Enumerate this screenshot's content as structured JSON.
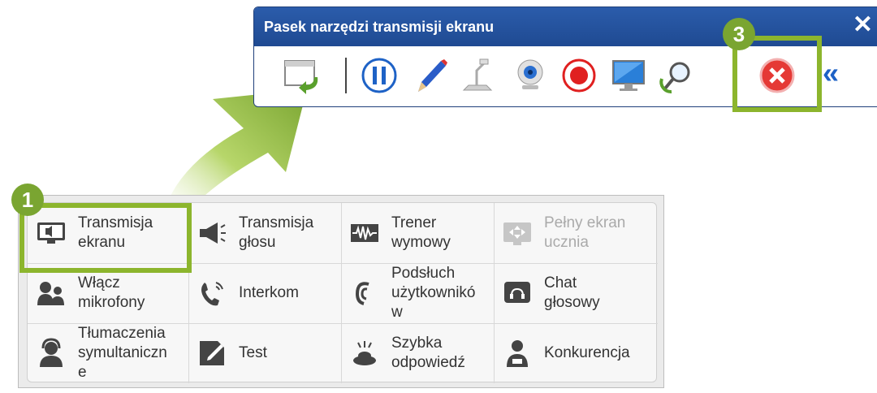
{
  "toolbar": {
    "title": "Pasek narzędzi transmisji ekranu",
    "close_glyph": "✕",
    "buttons": [
      {
        "name": "return-window-icon"
      },
      {
        "name": "pause-icon"
      },
      {
        "name": "pencil-icon"
      },
      {
        "name": "document-camera-icon"
      },
      {
        "name": "webcam-icon"
      },
      {
        "name": "record-icon"
      },
      {
        "name": "monitor-icon"
      },
      {
        "name": "zoom-icon"
      },
      {
        "name": "stop-icon"
      }
    ],
    "collapse_glyph": "«"
  },
  "callouts": {
    "one": "1",
    "three": "3"
  },
  "menu": {
    "items": [
      {
        "label": "Transmisja\nekranu",
        "icon": "screen-broadcast-icon",
        "enabled": true
      },
      {
        "label": "Transmisja\ngłosu",
        "icon": "megaphone-icon",
        "enabled": true
      },
      {
        "label": "Trener\nwymowy",
        "icon": "waveform-icon",
        "enabled": true
      },
      {
        "label": "Pełny ekran\nucznia",
        "icon": "fullscreen-icon",
        "enabled": false
      },
      {
        "label": "Włącz\nmikrofony",
        "icon": "users-mic-icon",
        "enabled": true
      },
      {
        "label": "Interkom",
        "icon": "phone-icon",
        "enabled": true
      },
      {
        "label": "Podsłuch\nużytkownikó\nw",
        "icon": "ear-icon",
        "enabled": true
      },
      {
        "label": "Chat\ngłosowy",
        "icon": "voice-chat-icon",
        "enabled": true
      },
      {
        "label": "Tłumaczenia\nsymultaniczn\ne",
        "icon": "interpreter-icon",
        "enabled": true
      },
      {
        "label": "Test",
        "icon": "test-icon",
        "enabled": true
      },
      {
        "label": "Szybka\nodpowiedź",
        "icon": "buzzer-icon",
        "enabled": true
      },
      {
        "label": "Konkurencja",
        "icon": "competition-icon",
        "enabled": true
      }
    ]
  },
  "colors": {
    "accent_green": "#8cb52d",
    "title_blue": "#2b5cab",
    "stop_red": "#e53935"
  }
}
